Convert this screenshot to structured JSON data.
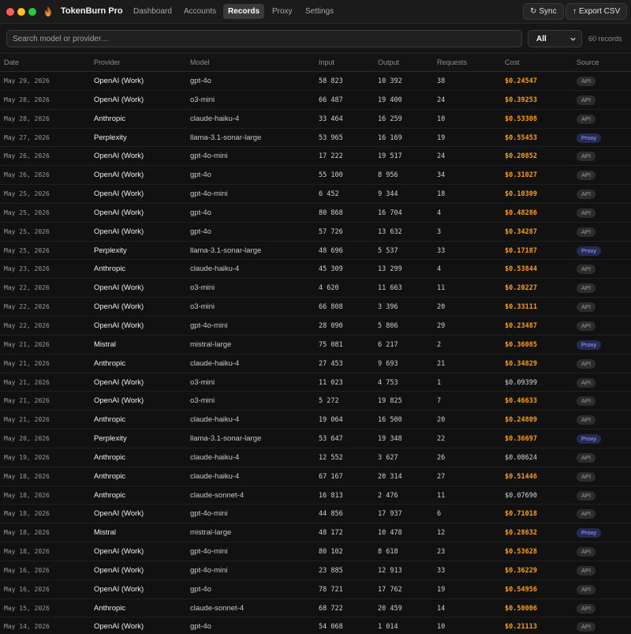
{
  "app": {
    "title": "TokenBurn Pro",
    "logo_icon": "flame-icon"
  },
  "nav": {
    "tabs": [
      {
        "label": "Dashboard",
        "active": false
      },
      {
        "label": "Accounts",
        "active": false
      },
      {
        "label": "Records",
        "active": true
      },
      {
        "label": "Proxy",
        "active": false
      },
      {
        "label": "Settings",
        "active": false
      }
    ]
  },
  "toolbar": {
    "sync_label": "Sync",
    "sync_icon": "↻",
    "export_label": "Export CSV",
    "export_icon": "↑"
  },
  "filters": {
    "search_placeholder": "Search model or provider…",
    "search_value": "",
    "source_selected": "All",
    "record_count": "60 records"
  },
  "colors": {
    "cost_high": "#ff9f1a",
    "proxy_badge": "#252a52",
    "api_badge": "#2c2c2c"
  },
  "table": {
    "headers": {
      "date": "Date",
      "provider": "Provider",
      "model": "Model",
      "input": "Input",
      "output": "Output",
      "requests": "Requests",
      "cost": "Cost",
      "source": "Source"
    },
    "rows": [
      {
        "date": "May 29, 2026",
        "provider": "OpenAI (Work)",
        "model": "gpt-4o",
        "input": "58 823",
        "output": "10 392",
        "requests": "38",
        "cost": "$0.24547",
        "high": true,
        "source": "API"
      },
      {
        "date": "May 28, 2026",
        "provider": "OpenAI (Work)",
        "model": "o3-mini",
        "input": "66 487",
        "output": "19 400",
        "requests": "24",
        "cost": "$0.39253",
        "high": true,
        "source": "API"
      },
      {
        "date": "May 28, 2026",
        "provider": "Anthropic",
        "model": "claude-haiku-4",
        "input": "33 464",
        "output": "16 259",
        "requests": "10",
        "cost": "$0.53308",
        "high": true,
        "source": "API"
      },
      {
        "date": "May 27, 2026",
        "provider": "Perplexity",
        "model": "llama-3.1-sonar-large",
        "input": "53 965",
        "output": "16 169",
        "requests": "19",
        "cost": "$0.55453",
        "high": true,
        "source": "Proxy"
      },
      {
        "date": "May 26, 2026",
        "provider": "OpenAI (Work)",
        "model": "gpt-4o-mini",
        "input": "17 222",
        "output": "19 517",
        "requests": "24",
        "cost": "$0.20852",
        "high": true,
        "source": "API"
      },
      {
        "date": "May 26, 2026",
        "provider": "OpenAI (Work)",
        "model": "gpt-4o",
        "input": "55 100",
        "output": "8 956",
        "requests": "34",
        "cost": "$0.31027",
        "high": true,
        "source": "API"
      },
      {
        "date": "May 25, 2026",
        "provider": "OpenAI (Work)",
        "model": "gpt-4o-mini",
        "input": "6 452",
        "output": "9 344",
        "requests": "18",
        "cost": "$0.10309",
        "high": true,
        "source": "API"
      },
      {
        "date": "May 25, 2026",
        "provider": "OpenAI (Work)",
        "model": "gpt-4o",
        "input": "80 868",
        "output": "16 704",
        "requests": "4",
        "cost": "$0.48286",
        "high": true,
        "source": "API"
      },
      {
        "date": "May 25, 2026",
        "provider": "OpenAI (Work)",
        "model": "gpt-4o",
        "input": "57 726",
        "output": "13 632",
        "requests": "3",
        "cost": "$0.34287",
        "high": true,
        "source": "API"
      },
      {
        "date": "May 25, 2026",
        "provider": "Perplexity",
        "model": "llama-3.1-sonar-large",
        "input": "48 696",
        "output": "5 537",
        "requests": "33",
        "cost": "$0.17187",
        "high": true,
        "source": "Proxy"
      },
      {
        "date": "May 23, 2026",
        "provider": "Anthropic",
        "model": "claude-haiku-4",
        "input": "45 309",
        "output": "13 299",
        "requests": "4",
        "cost": "$0.53844",
        "high": true,
        "source": "API"
      },
      {
        "date": "May 22, 2026",
        "provider": "OpenAI (Work)",
        "model": "o3-mini",
        "input": "4 620",
        "output": "11 663",
        "requests": "11",
        "cost": "$0.20227",
        "high": true,
        "source": "API"
      },
      {
        "date": "May 22, 2026",
        "provider": "OpenAI (Work)",
        "model": "o3-mini",
        "input": "66 808",
        "output": "3 396",
        "requests": "20",
        "cost": "$0.33111",
        "high": true,
        "source": "API"
      },
      {
        "date": "May 22, 2026",
        "provider": "OpenAI (Work)",
        "model": "gpt-4o-mini",
        "input": "28 090",
        "output": "5 806",
        "requests": "29",
        "cost": "$0.23487",
        "high": true,
        "source": "API"
      },
      {
        "date": "May 21, 2026",
        "provider": "Mistral",
        "model": "mistral-large",
        "input": "75 081",
        "output": "6 217",
        "requests": "2",
        "cost": "$0.36085",
        "high": true,
        "source": "Proxy"
      },
      {
        "date": "May 21, 2026",
        "provider": "Anthropic",
        "model": "claude-haiku-4",
        "input": "27 453",
        "output": "9 693",
        "requests": "21",
        "cost": "$0.34829",
        "high": true,
        "source": "API"
      },
      {
        "date": "May 21, 2026",
        "provider": "OpenAI (Work)",
        "model": "o3-mini",
        "input": "11 023",
        "output": "4 753",
        "requests": "1",
        "cost": "$0.09399",
        "high": false,
        "source": "API"
      },
      {
        "date": "May 21, 2026",
        "provider": "OpenAI (Work)",
        "model": "o3-mini",
        "input": "5 272",
        "output": "19 825",
        "requests": "7",
        "cost": "$0.46633",
        "high": true,
        "source": "API"
      },
      {
        "date": "May 21, 2026",
        "provider": "Anthropic",
        "model": "claude-haiku-4",
        "input": "19 064",
        "output": "16 500",
        "requests": "20",
        "cost": "$0.24809",
        "high": true,
        "source": "API"
      },
      {
        "date": "May 20, 2026",
        "provider": "Perplexity",
        "model": "llama-3.1-sonar-large",
        "input": "53 647",
        "output": "19 348",
        "requests": "22",
        "cost": "$0.36697",
        "high": true,
        "source": "Proxy"
      },
      {
        "date": "May 19, 2026",
        "provider": "Anthropic",
        "model": "claude-haiku-4",
        "input": "12 552",
        "output": "3 627",
        "requests": "26",
        "cost": "$0.08624",
        "high": false,
        "source": "API"
      },
      {
        "date": "May 18, 2026",
        "provider": "Anthropic",
        "model": "claude-haiku-4",
        "input": "67 167",
        "output": "20 314",
        "requests": "27",
        "cost": "$0.51446",
        "high": true,
        "source": "API"
      },
      {
        "date": "May 18, 2026",
        "provider": "Anthropic",
        "model": "claude-sonnet-4",
        "input": "16 813",
        "output": "2 476",
        "requests": "11",
        "cost": "$0.07690",
        "high": false,
        "source": "API"
      },
      {
        "date": "May 18, 2026",
        "provider": "OpenAI (Work)",
        "model": "gpt-4o-mini",
        "input": "44 856",
        "output": "17 937",
        "requests": "6",
        "cost": "$0.71018",
        "high": true,
        "source": "API"
      },
      {
        "date": "May 18, 2026",
        "provider": "Mistral",
        "model": "mistral-large",
        "input": "48 172",
        "output": "10 478",
        "requests": "12",
        "cost": "$0.28632",
        "high": true,
        "source": "Proxy"
      },
      {
        "date": "May 18, 2026",
        "provider": "OpenAI (Work)",
        "model": "gpt-4o-mini",
        "input": "80 102",
        "output": "8 618",
        "requests": "23",
        "cost": "$0.53628",
        "high": true,
        "source": "API"
      },
      {
        "date": "May 16, 2026",
        "provider": "OpenAI (Work)",
        "model": "gpt-4o-mini",
        "input": "23 885",
        "output": "12 913",
        "requests": "33",
        "cost": "$0.36229",
        "high": true,
        "source": "API"
      },
      {
        "date": "May 16, 2026",
        "provider": "OpenAI (Work)",
        "model": "gpt-4o",
        "input": "78 721",
        "output": "17 762",
        "requests": "19",
        "cost": "$0.54956",
        "high": true,
        "source": "API"
      },
      {
        "date": "May 15, 2026",
        "provider": "Anthropic",
        "model": "claude-sonnet-4",
        "input": "68 722",
        "output": "20 459",
        "requests": "14",
        "cost": "$0.50006",
        "high": true,
        "source": "API"
      },
      {
        "date": "May 14, 2026",
        "provider": "OpenAI (Work)",
        "model": "gpt-4o",
        "input": "54 068",
        "output": "1 014",
        "requests": "10",
        "cost": "$0.21113",
        "high": true,
        "source": "API"
      }
    ]
  }
}
